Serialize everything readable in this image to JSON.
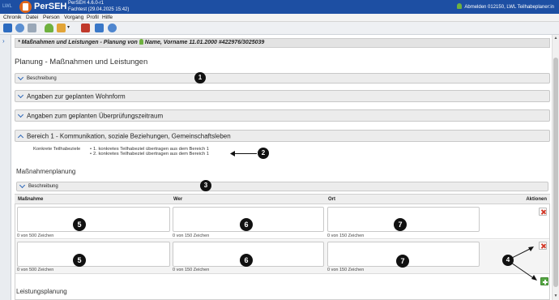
{
  "titlebar": {
    "app_name": "PerSEH",
    "version": "PerSEH 4.6.0-r1",
    "environment": "Fachtest (29.04.2025 15:42)",
    "user": "Abmelden 012150, LWL Teilhabeplaner:in"
  },
  "menu": [
    "Chronik",
    "Datei",
    "Person",
    "Vorgang",
    "Profil",
    "Hilfe"
  ],
  "page": {
    "header": "* Maßnahmen und Leistungen - Planung von",
    "person": "Name, Vorname 11.01.2000 #422976/3025039",
    "title": "Planung - Maßnahmen und Leistungen"
  },
  "panels": {
    "beschreibung": "Beschreibung",
    "wohnform": "Angaben zur geplanten Wohnform",
    "ueberpruefung": "Angaben zum geplanten Überprüfungszeitraum",
    "bereich1": "Bereich 1 - Kommunikation, soziale Beziehungen, Gemeinschaftsleben"
  },
  "goals": {
    "label": "Konkrete Teilhabeziele",
    "items": [
      "1. konkretes Teilhabeziel übertragen aus dem Bereich 1",
      "2. konkretes Teilhabeziel übertragen aus dem Bereich 1"
    ]
  },
  "massnahmen": {
    "heading": "Maßnahmenplanung",
    "beschreibung": "Beschreibung",
    "columns": {
      "massnahme": "Maßnahme",
      "wer": "Wer",
      "ort": "Ort",
      "aktionen": "Aktionen"
    },
    "rows": [
      {
        "massnahme_count": "0 von 500 Zeichen",
        "wer_count": "0 von 150 Zeichen",
        "ort_count": "0 von 150 Zeichen"
      },
      {
        "massnahme_count": "0 von 500 Zeichen",
        "wer_count": "0 von 150 Zeichen",
        "ort_count": "0 von 150 Zeichen"
      }
    ]
  },
  "leistungsplanung": {
    "heading": "Leistungsplanung"
  },
  "badges": [
    "1",
    "2",
    "3",
    "4",
    "5",
    "6",
    "7",
    "5",
    "6",
    "7"
  ],
  "colors": {
    "titlebar": "#1d4fa3",
    "panel": "#ececec",
    "accent": "#2a66b8",
    "delete": "#d23a2a",
    "add": "#54a642"
  }
}
